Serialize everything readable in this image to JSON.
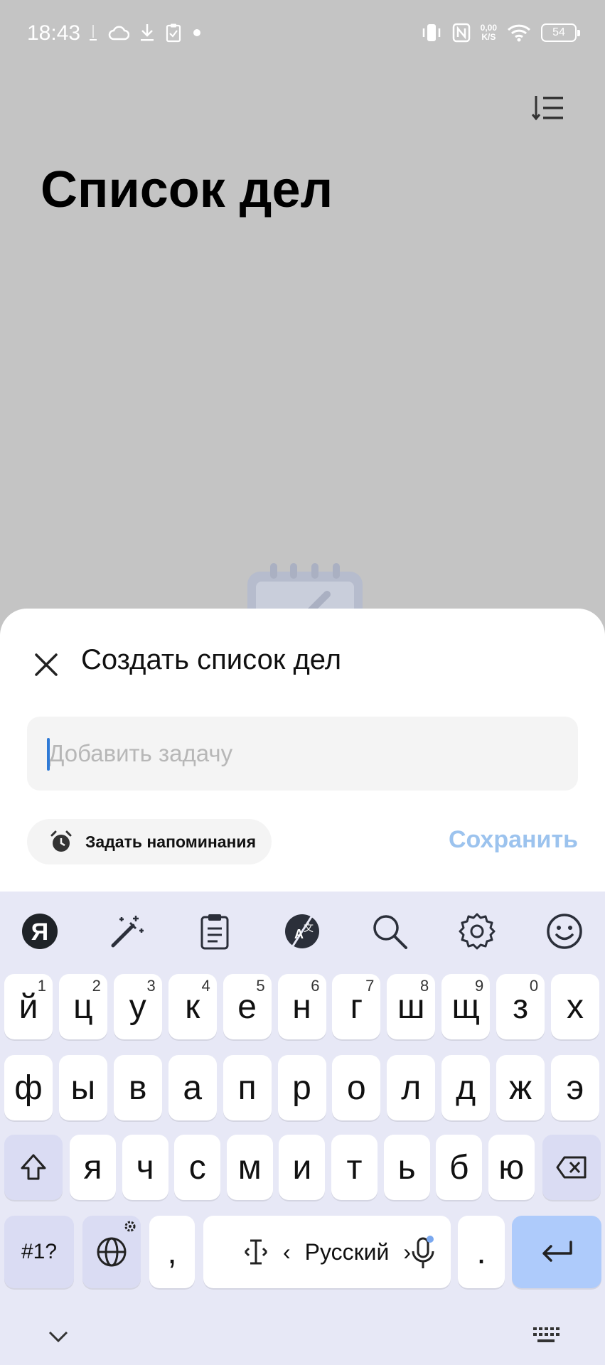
{
  "status_bar": {
    "time": "18:43",
    "net_speed_value": "0,00",
    "net_speed_unit": "K/S",
    "battery": "54"
  },
  "page": {
    "title": "Список дел"
  },
  "sheet": {
    "title": "Создать список дел",
    "input_placeholder": "Добавить задачу",
    "input_value": "",
    "reminder_label": "Задать напоминания",
    "save_label": "Сохранить"
  },
  "keyboard": {
    "row1": [
      {
        "ch": "й",
        "hint": "1"
      },
      {
        "ch": "ц",
        "hint": "2"
      },
      {
        "ch": "у",
        "hint": "3"
      },
      {
        "ch": "к",
        "hint": "4"
      },
      {
        "ch": "е",
        "hint": "5"
      },
      {
        "ch": "н",
        "hint": "6"
      },
      {
        "ch": "г",
        "hint": "7"
      },
      {
        "ch": "ш",
        "hint": "8"
      },
      {
        "ch": "щ",
        "hint": "9"
      },
      {
        "ch": "з",
        "hint": "0"
      },
      {
        "ch": "х",
        "hint": ""
      }
    ],
    "row2": [
      "ф",
      "ы",
      "в",
      "а",
      "п",
      "р",
      "о",
      "л",
      "д",
      "ж",
      "э"
    ],
    "row3": [
      "я",
      "ч",
      "с",
      "м",
      "и",
      "т",
      "ь",
      "б",
      "ю"
    ],
    "symbols_label": "#1?",
    "comma": ",",
    "period": ".",
    "language": "Русский",
    "lang_prev": "‹",
    "lang_next": "›"
  },
  "colors": {
    "accent": "#2f7ad6",
    "save_disabled": "#9cc3ee",
    "enter_key": "#aecbfb",
    "keyboard_bg": "#e7e8f6"
  }
}
